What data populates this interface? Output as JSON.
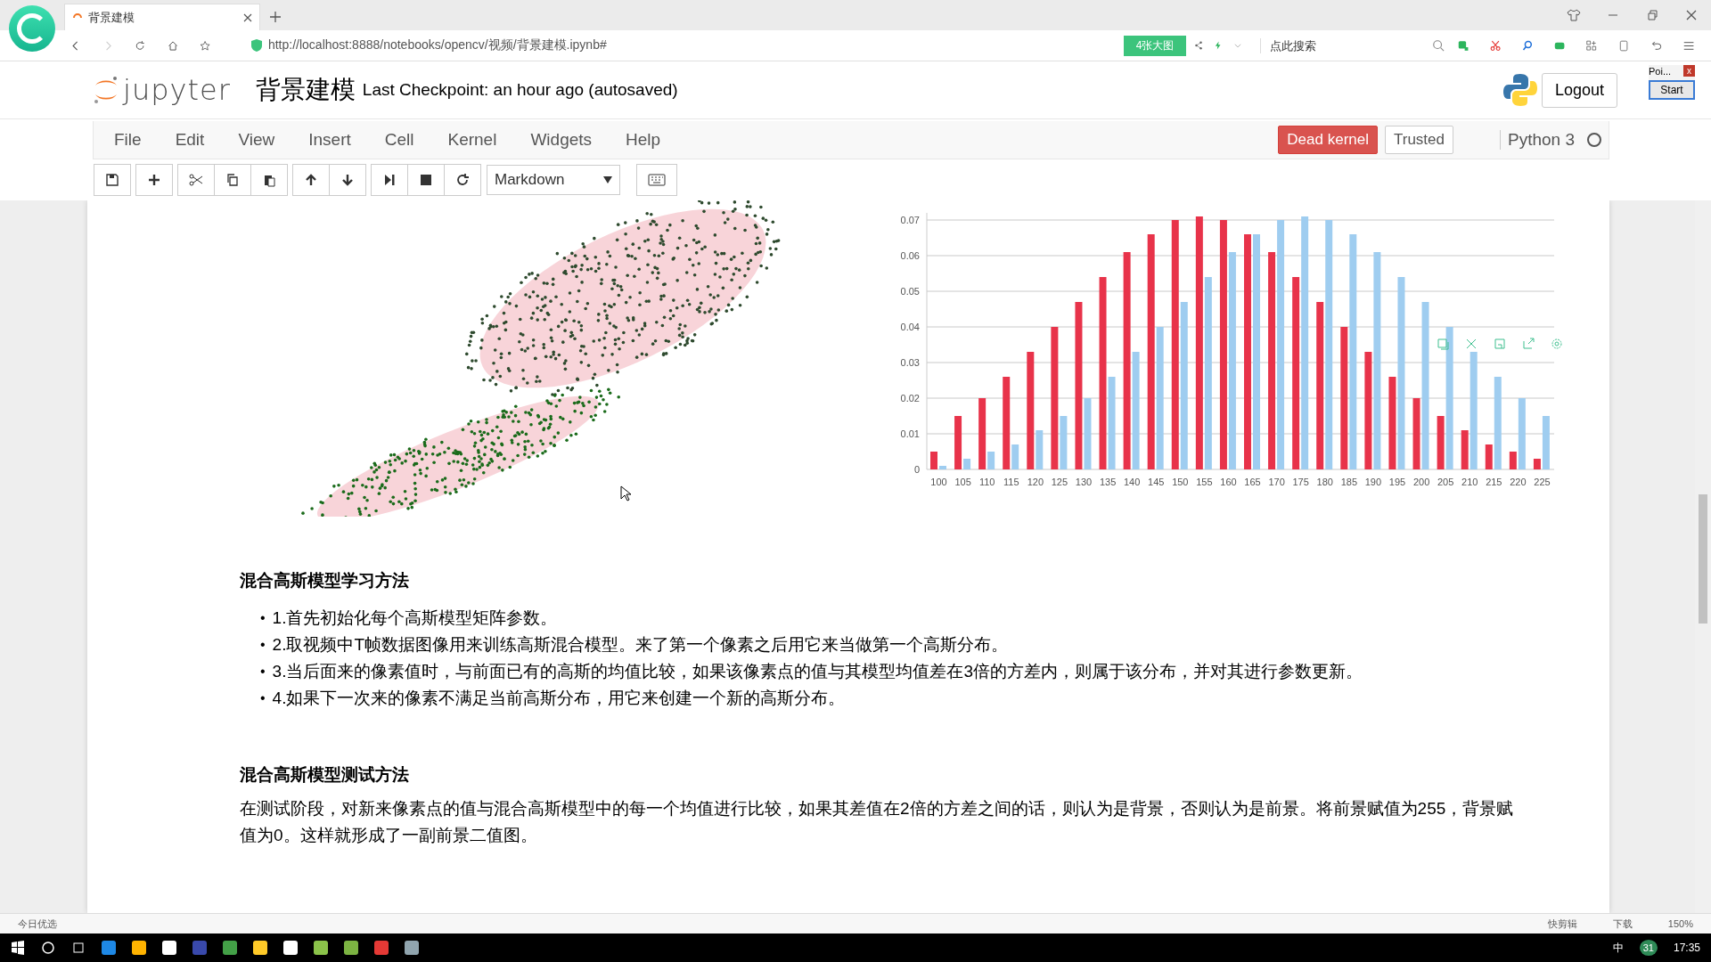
{
  "browser": {
    "tabs": [
      {
        "title": "背景建模",
        "selected": true
      }
    ],
    "address": "http://localhost:8888/notebooks/opencv/视频/背景建模.ipynb#",
    "badge": "4张大图",
    "search": {
      "placeholder": "点此搜索"
    }
  },
  "notebook": {
    "logo_text": "jupyter",
    "title": "背景建模",
    "checkpoint": "Last Checkpoint: an hour ago (autosaved)",
    "logout": "Logout"
  },
  "recorder": {
    "title": "Poi...",
    "close": "x",
    "start": "Start"
  },
  "menu": [
    "File",
    "Edit",
    "View",
    "Insert",
    "Cell",
    "Kernel",
    "Widgets",
    "Help"
  ],
  "kernel_status": {
    "label": "Dead kernel",
    "dead": true
  },
  "trusted": "Trusted",
  "kernel_name": "Python 3",
  "kernel_busy": false,
  "toolbar": {
    "cell_type": "Markdown"
  },
  "histogram": {
    "chart_data": {
      "type": "bar",
      "grid": true,
      "categories": [
        "100",
        "105",
        "110",
        "115",
        "120",
        "125",
        "130",
        "135",
        "140",
        "145",
        "150",
        "155",
        "160",
        "165",
        "170",
        "175",
        "180",
        "185",
        "190",
        "195",
        "200",
        "205",
        "210",
        "215",
        "220",
        "225"
      ],
      "series": [
        {
          "color": "#e8334a",
          "values": [
            0.005,
            0.015,
            0.02,
            0.026,
            0.033,
            0.04,
            0.047,
            0.054,
            0.061,
            0.066,
            0.07,
            0.071,
            0.07,
            0.066,
            0.061,
            0.054,
            0.047,
            0.04,
            0.033,
            0.026,
            0.02,
            0.015,
            0.011,
            0.007,
            0.005,
            0.003
          ]
        },
        {
          "color": "#9fcdf0",
          "values": [
            0.001,
            0.003,
            0.005,
            0.007,
            0.011,
            0.015,
            0.02,
            0.026,
            0.033,
            0.04,
            0.047,
            0.054,
            0.061,
            0.066,
            0.07,
            0.071,
            0.07,
            0.066,
            0.061,
            0.054,
            0.047,
            0.04,
            0.033,
            0.026,
            0.02,
            0.015
          ]
        }
      ],
      "ylim": [
        0,
        0.072
      ],
      "yticks": [
        0,
        0.01,
        0.02,
        0.03,
        0.04,
        0.05,
        0.06,
        0.07
      ]
    }
  },
  "sections": [
    {
      "heading": "混合高斯模型学习方法",
      "bullet": "•",
      "items": [
        "1.首先初始化每个高斯模型矩阵参数。",
        "2.取视频中T帧数据图像用来训练高斯混合模型。来了第一个像素之后用它来当做第一个高斯分布。",
        "3.当后面来的像素值时，与前面已有的高斯的均值比较，如果该像素点的值与其模型均值差在3倍的方差内，则属于该分布，并对其进行参数更新。",
        "4.如果下一次来的像素不满足当前高斯分布，用它来创建一个新的高斯分布。"
      ]
    },
    {
      "heading": "混合高斯模型测试方法",
      "paragraph": "在测试阶段，对新来像素点的值与混合高斯模型中的每一个均值进行比较，如果其差值在2倍的方差之间的话，则认为是背景，否则认为是前景。将前景赋值为255，背景赋值为0。这样就形成了一副前景二值图。"
    }
  ],
  "status_bar": {
    "left": "今日优选",
    "items": [
      "快剪辑",
      "下载",
      "150%"
    ]
  },
  "taskbar": {
    "ime": "中",
    "badge": "31",
    "time": "17:35"
  }
}
